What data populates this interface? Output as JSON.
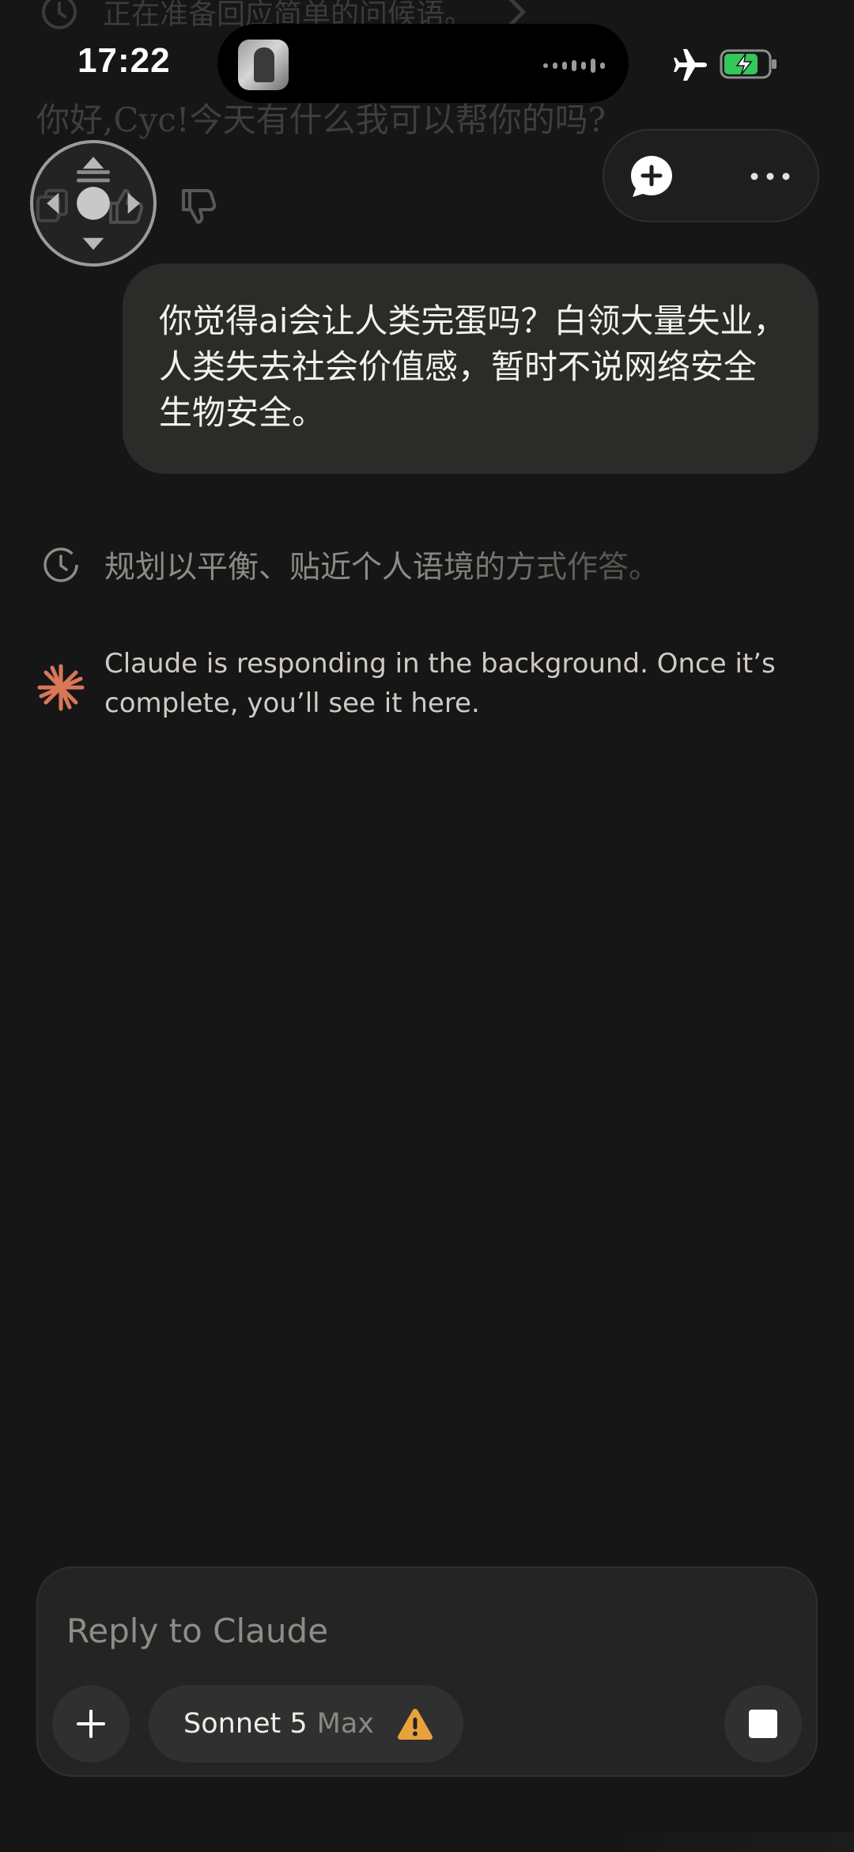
{
  "status_bar": {
    "time": "17:22"
  },
  "previous_turn": {
    "thinking_label": "正在准备回应简单的问候语。",
    "greeting": "你好,Cyc!今天有什么我可以帮你的吗?"
  },
  "user_message": "你觉得ai会让人类完蛋吗？白领大量失业，人类失去社会价值感，暂时不说网络安全生物安全。",
  "thinking": {
    "label": "规划以平衡、贴近个人语境的方式作答。"
  },
  "claude_status": "Claude is responding in the background. Once it’s complete, you’ll see it here.",
  "composer": {
    "placeholder": "Reply to Claude",
    "model_name": "Sonnet 5",
    "model_tier": "Max"
  },
  "colors": {
    "background": "#161616",
    "bubble": "#2b2b2a",
    "accent": "#d97757",
    "warning": "#e9a23b",
    "battery_charging": "#34c759"
  },
  "icons": [
    "clock-icon",
    "chevron-right-icon",
    "thumbs-up-icon",
    "thumbs-down-icon",
    "copy-icon",
    "airplane-icon",
    "battery-icon",
    "new-chat-icon",
    "more-icon",
    "claude-logo-icon",
    "plus-icon",
    "warning-icon",
    "stop-icon",
    "joystick-icon"
  ]
}
